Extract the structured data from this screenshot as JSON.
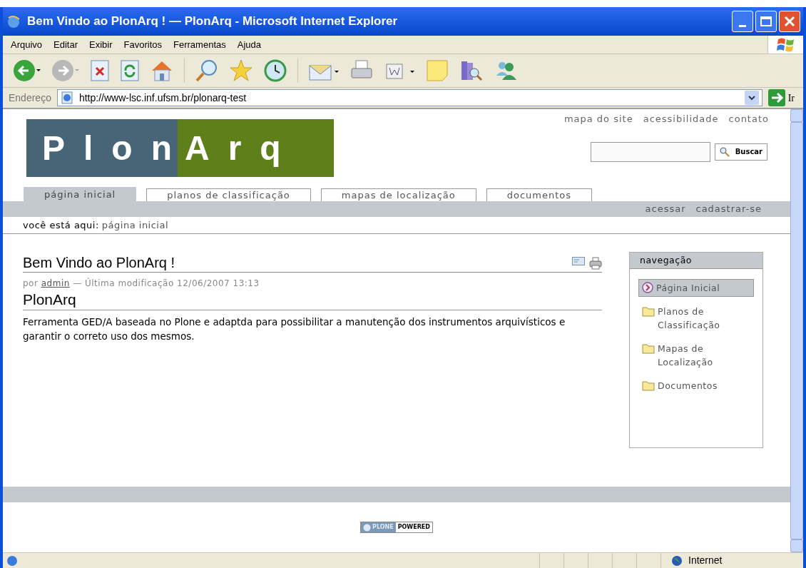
{
  "window": {
    "title": "Bem Vindo ao PlonArq ! — PlonArq - Microsoft Internet Explorer"
  },
  "menu": [
    "Arquivo",
    "Editar",
    "Exibir",
    "Favoritos",
    "Ferramentas",
    "Ajuda"
  ],
  "address_bar": {
    "label": "Endereço",
    "url": "http://www-lsc.inf.ufsm.br/plonarq-test",
    "go": "Ir"
  },
  "site_actions": [
    "mapa do site",
    "acessibilidade",
    "contato"
  ],
  "logo": {
    "left": "Plon",
    "right": "Arq"
  },
  "search": {
    "button": "Buscar"
  },
  "tabs": [
    {
      "label": "página inicial",
      "selected": true
    },
    {
      "label": "planos de classificação",
      "selected": false
    },
    {
      "label": "mapas de localização",
      "selected": false
    },
    {
      "label": "documentos",
      "selected": false
    }
  ],
  "personal_links": [
    "acessar",
    "cadastrar-se"
  ],
  "breadcrumb": {
    "label": "você está aqui:",
    "items": [
      "página inicial"
    ]
  },
  "article": {
    "title": "Bem Vindo ao PlonArq !",
    "byline_prefix": "por",
    "author": "admin",
    "modified": "— Última modificação 12/06/2007 13:13",
    "subtitle": "PlonArq",
    "body": "Ferramenta GED/A baseada no Plone e adaptda para possibilitar a manutenção dos instrumentos arquivísticos e garantir o correto uso dos mesmos."
  },
  "navigation": {
    "title": "navegação",
    "items": [
      {
        "label": "Página Inicial",
        "kind": "home",
        "selected": true
      },
      {
        "label": "Planos de Classificação",
        "kind": "folder",
        "selected": false
      },
      {
        "label": "Mapas de Localização",
        "kind": "folder",
        "selected": false
      },
      {
        "label": "Documentos",
        "kind": "folder",
        "selected": false
      }
    ]
  },
  "footer_badge": {
    "left": "PLONE",
    "right": "POWERED"
  },
  "status_bar": {
    "zone": "Internet"
  }
}
